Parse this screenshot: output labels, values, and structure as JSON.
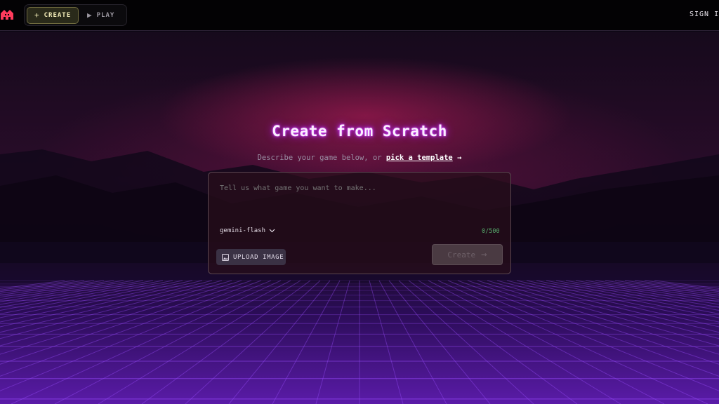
{
  "nav": {
    "create_label": "CREATE",
    "play_label": "PLAY",
    "signin_label": "SIGN IN"
  },
  "hero": {
    "title": "Create from Scratch",
    "subtitle_prefix": "Describe your game below, or ",
    "template_link": "pick a template"
  },
  "prompt": {
    "placeholder": "Tell us what game you want to make...",
    "value": ""
  },
  "model": {
    "selected": "gemini-flash"
  },
  "counter": "0/500",
  "buttons": {
    "upload_label": "UPLOAD IMAGE",
    "create_label": "Create"
  },
  "colors": {
    "accent_title_glow": "#c02cff",
    "create_active": "#f3ecb8",
    "counter_green": "#55a96a",
    "logo_red": "#ff3b5c"
  },
  "icons": {
    "logo": "logo-icon",
    "create": "plus-icon",
    "play": "play-icon",
    "model": "chevron-down-icon",
    "upload": "image-icon",
    "create_arrow": "arrow-right-icon"
  }
}
